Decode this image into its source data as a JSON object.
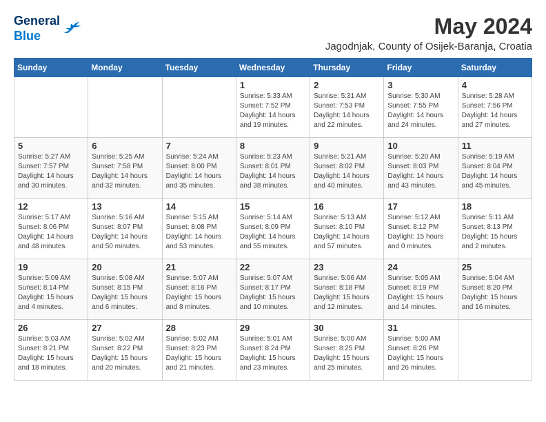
{
  "logo": {
    "line1": "General",
    "line2": "Blue"
  },
  "title": "May 2024",
  "subtitle": "Jagodnjak, County of Osijek-Baranja, Croatia",
  "weekdays": [
    "Sunday",
    "Monday",
    "Tuesday",
    "Wednesday",
    "Thursday",
    "Friday",
    "Saturday"
  ],
  "weeks": [
    [
      {
        "day": "",
        "info": ""
      },
      {
        "day": "",
        "info": ""
      },
      {
        "day": "",
        "info": ""
      },
      {
        "day": "1",
        "info": "Sunrise: 5:33 AM\nSunset: 7:52 PM\nDaylight: 14 hours\nand 19 minutes."
      },
      {
        "day": "2",
        "info": "Sunrise: 5:31 AM\nSunset: 7:53 PM\nDaylight: 14 hours\nand 22 minutes."
      },
      {
        "day": "3",
        "info": "Sunrise: 5:30 AM\nSunset: 7:55 PM\nDaylight: 14 hours\nand 24 minutes."
      },
      {
        "day": "4",
        "info": "Sunrise: 5:28 AM\nSunset: 7:56 PM\nDaylight: 14 hours\nand 27 minutes."
      }
    ],
    [
      {
        "day": "5",
        "info": "Sunrise: 5:27 AM\nSunset: 7:57 PM\nDaylight: 14 hours\nand 30 minutes."
      },
      {
        "day": "6",
        "info": "Sunrise: 5:25 AM\nSunset: 7:58 PM\nDaylight: 14 hours\nand 32 minutes."
      },
      {
        "day": "7",
        "info": "Sunrise: 5:24 AM\nSunset: 8:00 PM\nDaylight: 14 hours\nand 35 minutes."
      },
      {
        "day": "8",
        "info": "Sunrise: 5:23 AM\nSunset: 8:01 PM\nDaylight: 14 hours\nand 38 minutes."
      },
      {
        "day": "9",
        "info": "Sunrise: 5:21 AM\nSunset: 8:02 PM\nDaylight: 14 hours\nand 40 minutes."
      },
      {
        "day": "10",
        "info": "Sunrise: 5:20 AM\nSunset: 8:03 PM\nDaylight: 14 hours\nand 43 minutes."
      },
      {
        "day": "11",
        "info": "Sunrise: 5:19 AM\nSunset: 8:04 PM\nDaylight: 14 hours\nand 45 minutes."
      }
    ],
    [
      {
        "day": "12",
        "info": "Sunrise: 5:17 AM\nSunset: 8:06 PM\nDaylight: 14 hours\nand 48 minutes."
      },
      {
        "day": "13",
        "info": "Sunrise: 5:16 AM\nSunset: 8:07 PM\nDaylight: 14 hours\nand 50 minutes."
      },
      {
        "day": "14",
        "info": "Sunrise: 5:15 AM\nSunset: 8:08 PM\nDaylight: 14 hours\nand 53 minutes."
      },
      {
        "day": "15",
        "info": "Sunrise: 5:14 AM\nSunset: 8:09 PM\nDaylight: 14 hours\nand 55 minutes."
      },
      {
        "day": "16",
        "info": "Sunrise: 5:13 AM\nSunset: 8:10 PM\nDaylight: 14 hours\nand 57 minutes."
      },
      {
        "day": "17",
        "info": "Sunrise: 5:12 AM\nSunset: 8:12 PM\nDaylight: 15 hours\nand 0 minutes."
      },
      {
        "day": "18",
        "info": "Sunrise: 5:11 AM\nSunset: 8:13 PM\nDaylight: 15 hours\nand 2 minutes."
      }
    ],
    [
      {
        "day": "19",
        "info": "Sunrise: 5:09 AM\nSunset: 8:14 PM\nDaylight: 15 hours\nand 4 minutes."
      },
      {
        "day": "20",
        "info": "Sunrise: 5:08 AM\nSunset: 8:15 PM\nDaylight: 15 hours\nand 6 minutes."
      },
      {
        "day": "21",
        "info": "Sunrise: 5:07 AM\nSunset: 8:16 PM\nDaylight: 15 hours\nand 8 minutes."
      },
      {
        "day": "22",
        "info": "Sunrise: 5:07 AM\nSunset: 8:17 PM\nDaylight: 15 hours\nand 10 minutes."
      },
      {
        "day": "23",
        "info": "Sunrise: 5:06 AM\nSunset: 8:18 PM\nDaylight: 15 hours\nand 12 minutes."
      },
      {
        "day": "24",
        "info": "Sunrise: 5:05 AM\nSunset: 8:19 PM\nDaylight: 15 hours\nand 14 minutes."
      },
      {
        "day": "25",
        "info": "Sunrise: 5:04 AM\nSunset: 8:20 PM\nDaylight: 15 hours\nand 16 minutes."
      }
    ],
    [
      {
        "day": "26",
        "info": "Sunrise: 5:03 AM\nSunset: 8:21 PM\nDaylight: 15 hours\nand 18 minutes."
      },
      {
        "day": "27",
        "info": "Sunrise: 5:02 AM\nSunset: 8:22 PM\nDaylight: 15 hours\nand 20 minutes."
      },
      {
        "day": "28",
        "info": "Sunrise: 5:02 AM\nSunset: 8:23 PM\nDaylight: 15 hours\nand 21 minutes."
      },
      {
        "day": "29",
        "info": "Sunrise: 5:01 AM\nSunset: 8:24 PM\nDaylight: 15 hours\nand 23 minutes."
      },
      {
        "day": "30",
        "info": "Sunrise: 5:00 AM\nSunset: 8:25 PM\nDaylight: 15 hours\nand 25 minutes."
      },
      {
        "day": "31",
        "info": "Sunrise: 5:00 AM\nSunset: 8:26 PM\nDaylight: 15 hours\nand 26 minutes."
      },
      {
        "day": "",
        "info": ""
      }
    ]
  ]
}
